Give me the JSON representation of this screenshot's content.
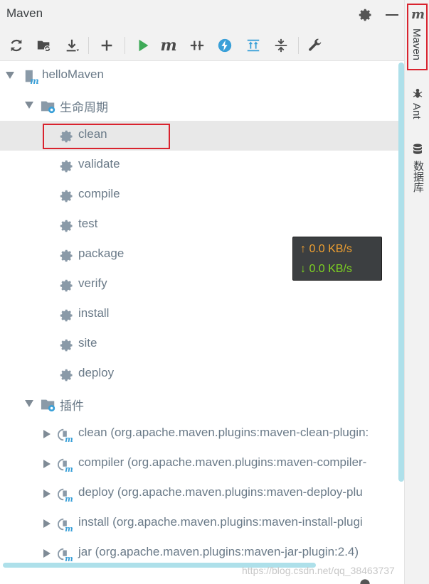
{
  "panel": {
    "title": "Maven"
  },
  "toolbar": {
    "items": [
      "reload-icon",
      "generate-sources-icon",
      "download-icon",
      "add-icon",
      "run-icon",
      "maven-goal-icon",
      "toggle-offline-icon",
      "skip-tests-icon",
      "show-dependencies-icon",
      "collapse-all-icon",
      "settings-wrench-icon"
    ],
    "goal_letter": "m"
  },
  "strip": {
    "maven_letter": "m",
    "maven_label": "Maven",
    "ant_label": "Ant",
    "db_label": "数据库"
  },
  "tree": {
    "project": "helloMaven",
    "lifecycle": {
      "label": "生命周期",
      "phases": [
        "clean",
        "validate",
        "compile",
        "test",
        "package",
        "verify",
        "install",
        "site",
        "deploy"
      ]
    },
    "plugins": {
      "label": "插件",
      "items": [
        "clean (org.apache.maven.plugins:maven-clean-plugin:",
        "compiler (org.apache.maven.plugins:maven-compiler-",
        "deploy (org.apache.maven.plugins:maven-deploy-plu",
        "install (org.apache.maven.plugins:maven-install-plugi",
        "jar (org.apache.maven.plugins:maven-jar-plugin:2.4)"
      ]
    }
  },
  "network": {
    "up": "↑ 0.0 KB/s",
    "down": "↓ 0.0 KB/s"
  },
  "watermark": "https://blog.csdn.net/qq_38463737",
  "colors": {
    "selection": "#e8e8e8",
    "highlight_border": "#d9232e",
    "run_green": "#3faa58",
    "accent_blue": "#3aa0d8"
  }
}
